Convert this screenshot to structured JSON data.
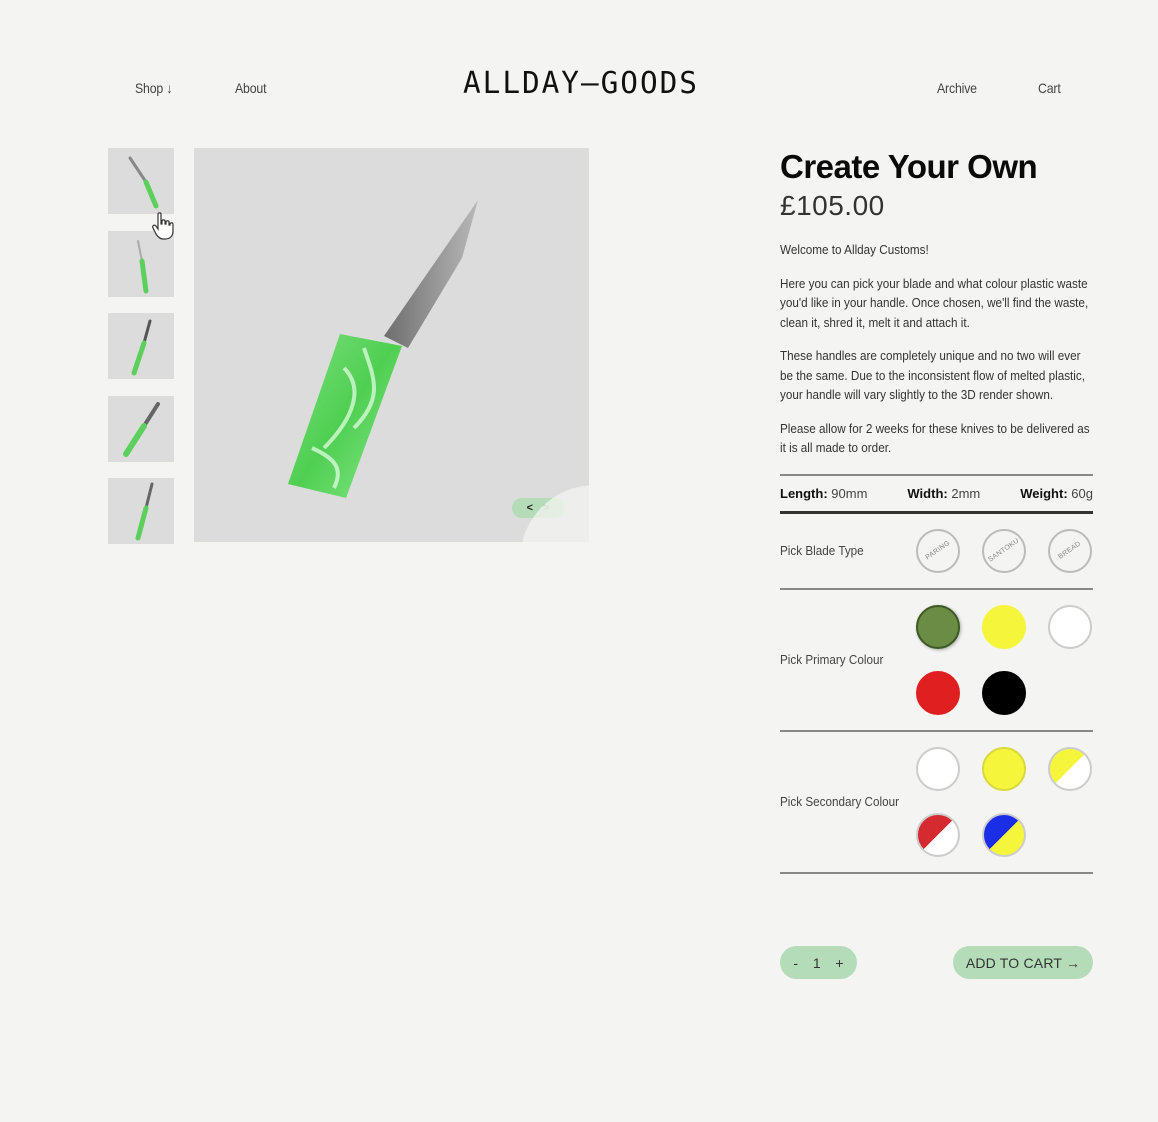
{
  "header": {
    "nav_left": [
      {
        "label": "Shop ↓"
      },
      {
        "label": "About"
      }
    ],
    "logo": "ALLDAY—GOODS",
    "nav_right": [
      {
        "label": "Archive"
      },
      {
        "label": "Cart"
      }
    ]
  },
  "gallery": {
    "thumbnail_count": 5,
    "nav_prev": "<",
    "nav_next": ">"
  },
  "product": {
    "title": "Create Your Own",
    "price": "£105.00",
    "description": [
      "Welcome to Allday Customs!",
      "Here you can pick your blade and what colour plastic waste you'd like in your handle. Once chosen, we'll find the waste, clean it, shred it, melt it and attach it.",
      "These handles are completely unique and no two will ever be the same. Due to the inconsistent flow of melted plastic, your handle will vary slightly to the 3D render shown.",
      "Please allow for 2 weeks for these knives to be delivered as it is all made to order."
    ],
    "specs": [
      {
        "label": "Length:",
        "value": "90mm"
      },
      {
        "label": "Width:",
        "value": "2mm"
      },
      {
        "label": "Weight:",
        "value": "60g"
      }
    ],
    "blade": {
      "label": "Pick Blade Type",
      "options": [
        "PARING",
        "SANTOKU",
        "BREAD"
      ]
    },
    "primary": {
      "label": "Pick Primary Colour",
      "options": [
        {
          "name": "green",
          "color": "#6a8c44",
          "selected": true
        },
        {
          "name": "yellow",
          "color": "#f5f53c"
        },
        {
          "name": "white",
          "color": "#ffffff"
        },
        {
          "name": "red",
          "color": "#e02020"
        },
        {
          "name": "black",
          "color": "#000000"
        }
      ]
    },
    "secondary": {
      "label": "Pick Secondary Colour",
      "options": [
        {
          "name": "white",
          "a": "#ffffff",
          "b": "#ffffff"
        },
        {
          "name": "yellow",
          "a": "#f5f53c",
          "b": "#f5f53c"
        },
        {
          "name": "yellow-white",
          "a": "#f5f53c",
          "b": "#ffffff"
        },
        {
          "name": "red-white",
          "a": "#d42a30",
          "b": "#ffffff"
        },
        {
          "name": "blue-yellow",
          "a": "#1a2ee8",
          "b": "#f5f53c"
        }
      ]
    },
    "quantity": {
      "minus": "-",
      "value": "1",
      "plus": "+"
    },
    "add_to_cart": "ADD TO CART →"
  },
  "colors": {
    "accent": "#b4dcb8",
    "background": "#f4f4f2",
    "image_bg": "#dcdcdc"
  }
}
